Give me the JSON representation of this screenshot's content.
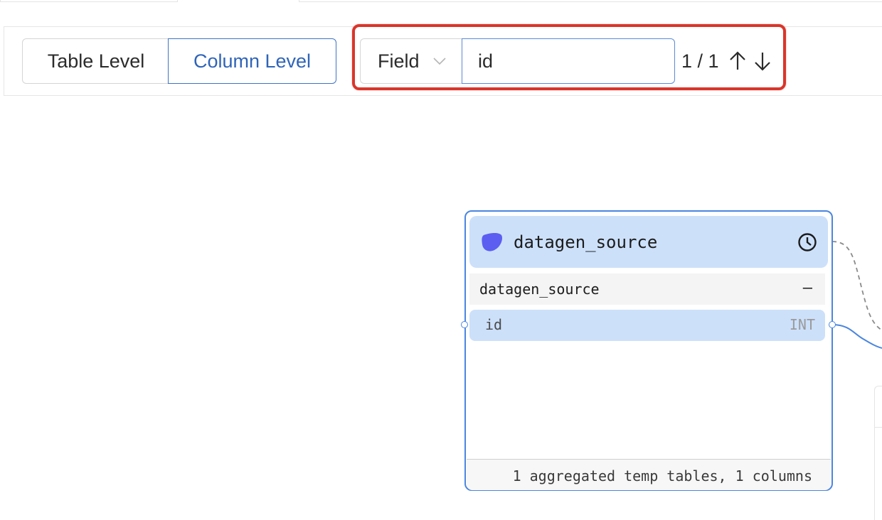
{
  "toolbar": {
    "level_toggle": {
      "table_label": "Table Level",
      "column_label": "Column Level",
      "selected": "Column Level"
    },
    "search": {
      "scope_label": "Field",
      "query": "id",
      "match_count": "1 / 1"
    }
  },
  "node": {
    "title": "datagen_source",
    "table_name": "datagen_source",
    "collapse_symbol": "–",
    "columns": [
      {
        "name": "id",
        "type": "INT"
      }
    ],
    "footer": "1 aggregated temp tables, 1 columns"
  },
  "icons": {
    "node_logo": "source-logo-icon",
    "history": "clock-icon",
    "prev": "arrow-up-icon",
    "next": "arrow-down-icon",
    "dropdown": "chevron-down-icon"
  },
  "colors": {
    "accent": "#3f73c4",
    "node_border": "#4a86e0",
    "node_header_bg": "#cce0fa",
    "highlight_box": "#d9352b",
    "logo": "#5b5ef0"
  }
}
